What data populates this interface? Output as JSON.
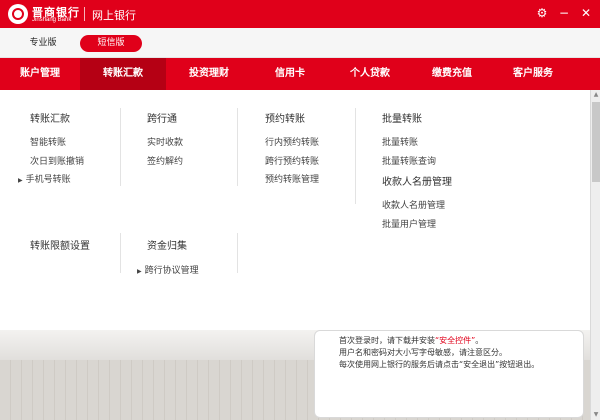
{
  "window": {
    "brand_cn": "晋商银行",
    "brand_en": "Jinshang Bank",
    "title": "网上银行",
    "accent": "#e0001a"
  },
  "modes": {
    "pro": "专业版",
    "sms": "短信版"
  },
  "nav": [
    {
      "label": "账户管理"
    },
    {
      "label": "转账汇款"
    },
    {
      "label": "投资理财"
    },
    {
      "label": "信用卡"
    },
    {
      "label": "个人贷款"
    },
    {
      "label": "缴费充值"
    },
    {
      "label": "客户服务"
    }
  ],
  "menu": {
    "transfer": {
      "title": "转账汇款",
      "items": [
        "智能转账",
        "次日到账撤销",
        "手机号转账"
      ]
    },
    "crossbank": {
      "title": "跨行通",
      "items": [
        "实时收款",
        "签约解约"
      ]
    },
    "scheduled": {
      "title": "预约转账",
      "items": [
        "行内预约转账",
        "跨行预约转账",
        "预约转账管理"
      ]
    },
    "batch": {
      "title": "批量转账",
      "items": [
        "批量转账",
        "批量转账查询"
      ],
      "payee_title": "收款人名册管理",
      "payee_items": [
        "收款人名册管理",
        "批量用户管理"
      ]
    },
    "limit": {
      "title": "转账限额设置"
    },
    "pooling": {
      "title": "资金归集",
      "items": [
        "跨行协议管理"
      ]
    }
  },
  "notice": {
    "line1_pre": "首次登录时，请下载并安装",
    "line1_link": "“安全控件”",
    "line1_post": "。",
    "line2": "用户名和密码对大小写字母敏感，请注意区分。",
    "line3": "每次使用网上银行的服务后请点击“安全退出”按钮退出。"
  }
}
